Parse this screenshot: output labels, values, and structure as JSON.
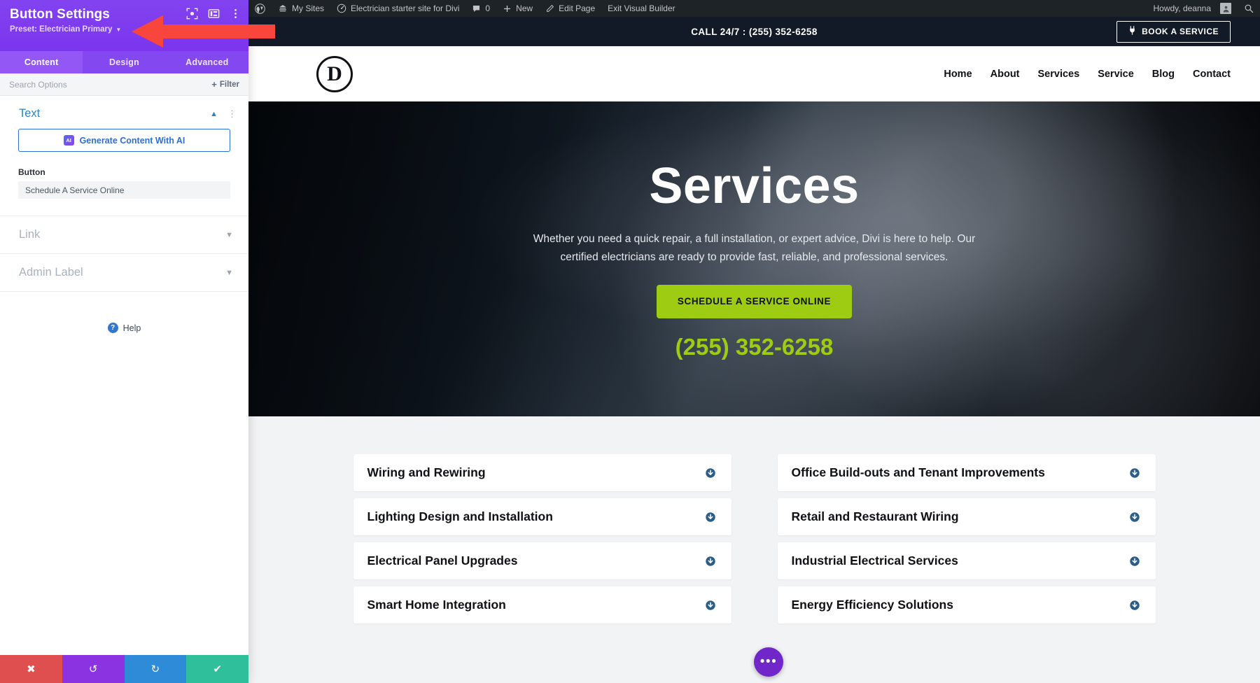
{
  "panel": {
    "title": "Button Settings",
    "preset_label": "Preset: Electrician Primary",
    "icons": [
      "focus-target-icon",
      "layout-columns-icon",
      "kebab-menu-icon"
    ],
    "tabs": [
      {
        "label": "Content",
        "active": true
      },
      {
        "label": "Design",
        "active": false
      },
      {
        "label": "Advanced",
        "active": false
      }
    ],
    "search_placeholder": "Search Options",
    "filter_label": "Filter",
    "sections": {
      "text": {
        "title": "Text",
        "ai_button_label": "Generate Content With AI",
        "ai_badge": "AI",
        "button_field_label": "Button",
        "button_field_value": "Schedule A Service Online"
      },
      "link": {
        "title": "Link"
      },
      "admin_label": {
        "title": "Admin Label"
      }
    },
    "help_label": "Help",
    "actions": [
      {
        "name": "close",
        "glyph": "✖",
        "color": "#e04f4f"
      },
      {
        "name": "undo",
        "glyph": "↺",
        "color": "#8b33e0"
      },
      {
        "name": "redo",
        "glyph": "↻",
        "color": "#2e8bd8"
      },
      {
        "name": "save",
        "glyph": "✔",
        "color": "#2fbf9a"
      }
    ]
  },
  "wp_admin_bar": {
    "items": [
      {
        "label": "My Sites",
        "icon": "sites-icon"
      },
      {
        "label": "Electrician starter site for Divi",
        "icon": "dashboard-icon"
      },
      {
        "label": "0",
        "icon": "comment-icon"
      },
      {
        "label": "New",
        "icon": "plus-icon"
      },
      {
        "label": "Edit Page",
        "icon": "pencil-icon"
      },
      {
        "label": "Exit Visual Builder",
        "icon": ""
      }
    ],
    "greeting": "Howdy, deanna",
    "search_icon": "search-icon"
  },
  "site": {
    "topbar": {
      "phone_text": "CALL 24/7 : (255) 352-6258",
      "book_button": "BOOK A SERVICE",
      "book_icon": "plug-icon"
    },
    "header": {
      "logo_letter": "D",
      "nav": [
        "Home",
        "About",
        "Services",
        "Service",
        "Blog",
        "Contact"
      ]
    },
    "hero": {
      "heading": "Services",
      "paragraph": "Whether you need a quick repair, a full installation, or expert advice, Divi is here to help. Our certified electricians are ready to provide fast, reliable, and professional services.",
      "cta_label": "SCHEDULE A SERVICE ONLINE",
      "phone": "(255) 352-6258",
      "accent_color": "#9ecc12"
    },
    "services": {
      "left_column": [
        "Wiring and Rewiring",
        "Lighting Design and Installation",
        "Electrical Panel Upgrades",
        "Smart Home Integration"
      ],
      "right_column": [
        "Office Build-outs and Tenant Improvements",
        "Retail and Restaurant Wiring",
        "Industrial Electrical Services",
        "Energy Efficiency Solutions"
      ],
      "toggle_icon": "circle-arrow-down-icon"
    },
    "fab": {
      "icon": "ellipsis-icon",
      "glyph": "•••",
      "color": "#7126c9"
    }
  },
  "annotation": {
    "arrow_color": "#f9463c",
    "shape": "left-arrow"
  }
}
